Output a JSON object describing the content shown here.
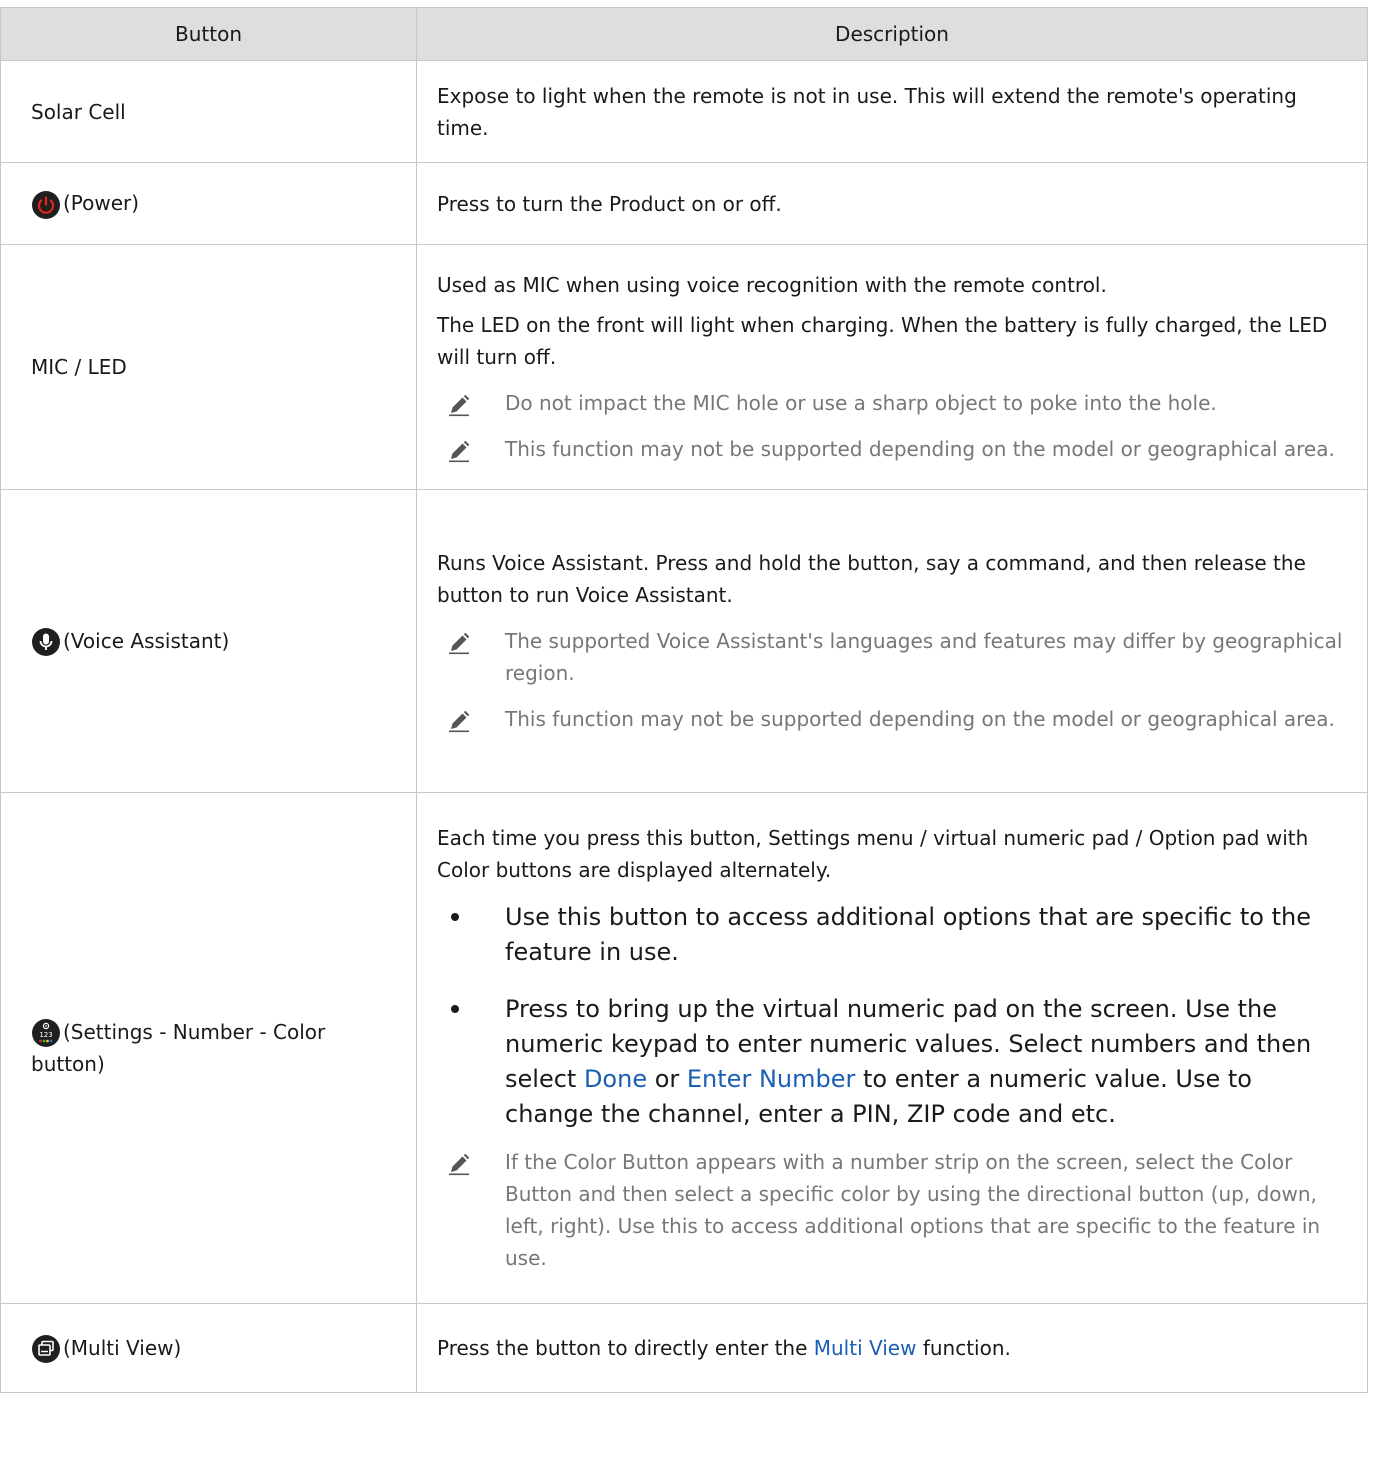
{
  "table": {
    "headers": {
      "button": "Button",
      "description": "Description"
    },
    "rows": [
      {
        "button": "Solar Cell",
        "description": "Expose to light when the remote is not in use. This will extend the remote's operating time."
      },
      {
        "icon": "power-icon",
        "button": "(Power)",
        "description": "Press to turn the Product on or off."
      },
      {
        "button": "MIC / LED",
        "description": "Used as MIC when using voice recognition with the remote control.",
        "description2": "The LED on the front will light when charging. When the battery is fully charged, the LED will turn off.",
        "notes": [
          "Do not impact the MIC hole or use a sharp object to poke into the hole.",
          "This function may not be supported depending on the model or geographical area."
        ]
      },
      {
        "icon": "microphone-icon",
        "button": "(Voice Assistant)",
        "description": "Runs Voice Assistant. Press and hold the button, say a command, and then release the button to run Voice Assistant.",
        "notes": [
          "The supported Voice Assistant's languages and features may differ by geographical region.",
          "This function may not be supported depending on the model or geographical area."
        ]
      },
      {
        "icon": "settings-number-color-icon",
        "button": "(Settings - Number - Color button)",
        "description": "Each time you press this button, Settings menu / virtual numeric pad / Option pad with Color buttons are displayed alternately.",
        "bullet1": "Use this button to access additional options that are specific to the feature in use.",
        "bullet2_part1": "Press to bring up the virtual numeric pad on the screen. Use the numeric keypad to enter numeric values. Select numbers and then select ",
        "bullet2_link1": "Done",
        "bullet2_part2": " or ",
        "bullet2_link2": "Enter Number",
        "bullet2_part3": " to enter a numeric value. Use to change the channel, enter a PIN, ZIP code and etc.",
        "note": "If the Color Button appears with a number strip on the screen, select the Color Button and then select a specific color by using the directional button (up, down, left, right). Use this to access additional options that are specific to the feature in use."
      },
      {
        "icon": "multi-view-icon",
        "button": "(Multi View)",
        "description_part1": "Press the button to directly enter the ",
        "description_link": "Multi View",
        "description_part2": " function."
      }
    ]
  },
  "colors": {
    "header_bg": "#dedede",
    "border": "#c8c8c8",
    "link": "#1a5fb4",
    "note_text": "#777777",
    "power_red": "#e1261c"
  }
}
